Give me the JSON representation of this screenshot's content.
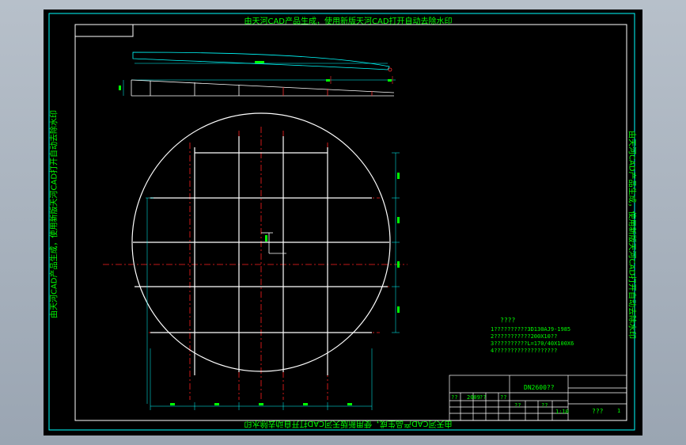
{
  "watermark": "由天河CAD产品生成，使用新版天河CAD打开自动去除水印",
  "notes": {
    "title": "????",
    "lines": [
      "1??????????3D130AJ9-1985",
      "2???????????200X10??",
      "3??????????L=170/40X100X6",
      "4???????????????????"
    ]
  },
  "title_block": {
    "drawing_name": "DN2600??",
    "scale": "1:10",
    "sheet": "1",
    "drawing_no": "???",
    "row_cells": [
      "??",
      "2009",
      "??",
      "??",
      "??",
      "??"
    ]
  },
  "colors": {
    "frame": "#00ffff",
    "geometry": "#ffffff",
    "centerline": "#ff0000",
    "text": "#00ff00",
    "dimension": "#00ffff"
  }
}
